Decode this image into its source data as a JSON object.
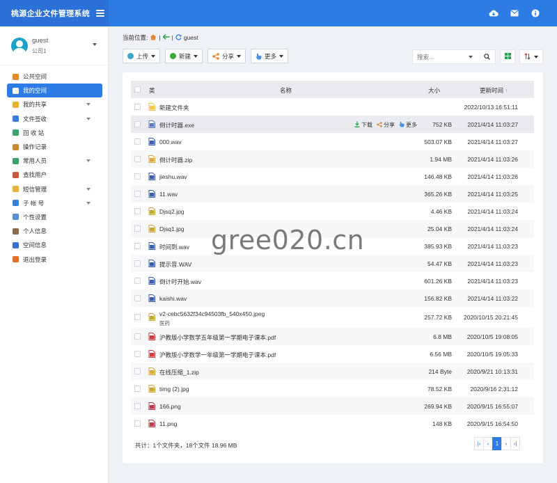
{
  "app": {
    "title": "桃源企业文件管理系统"
  },
  "header": {
    "icons": [
      "cloud-download-icon",
      "mail-icon",
      "info-icon"
    ]
  },
  "user": {
    "name": "guest",
    "company": "公司1"
  },
  "sidebar": {
    "items": [
      {
        "label": "公共空间",
        "icon": "public-space-icon",
        "color": "#e08a2e",
        "caret": false
      },
      {
        "label": "我的空间",
        "icon": "my-space-icon",
        "color": "#ffffff",
        "caret": false,
        "active": true
      },
      {
        "label": "我的共享",
        "icon": "share-folder-icon",
        "color": "#e6b23a",
        "caret": true
      },
      {
        "label": "文件签收",
        "icon": "sign-icon",
        "color": "#3a7fd6",
        "caret": true
      },
      {
        "label": "回 收 站",
        "icon": "recycle-icon",
        "color": "#3aa36b",
        "caret": false
      },
      {
        "label": "操作记录",
        "icon": "log-icon",
        "color": "#c58a3a",
        "caret": false
      },
      {
        "label": "常用人员",
        "icon": "contacts-icon",
        "color": "#3aa36b",
        "caret": true
      },
      {
        "label": "查找用户",
        "icon": "find-user-icon",
        "color": "#c55a3a",
        "caret": false
      },
      {
        "label": "短信管理",
        "icon": "sms-icon",
        "color": "#e6b23a",
        "caret": true
      },
      {
        "label": "子 帐 号",
        "icon": "sub-account-icon",
        "color": "#3a7fd6",
        "caret": true
      },
      {
        "label": "个性设置",
        "icon": "settings-icon",
        "color": "#5a8fd6",
        "caret": false
      },
      {
        "label": "个人信息",
        "icon": "profile-icon",
        "color": "#8a6a4a",
        "caret": false
      },
      {
        "label": "空间信息",
        "icon": "space-info-icon",
        "color": "#3a6fd6",
        "caret": false
      },
      {
        "label": "退出登录",
        "icon": "logout-icon",
        "color": "#e0702e",
        "caret": false
      }
    ]
  },
  "breadcrumb": {
    "prefix": "当前位置:",
    "current": "guest",
    "sep": "|"
  },
  "toolbar": {
    "upload": "上传",
    "new": "新建",
    "share": "分享",
    "more": "更多"
  },
  "search": {
    "placeholder": "搜索..."
  },
  "table": {
    "headers": {
      "type": "类",
      "name": "名称",
      "size": "大小",
      "time": "更新时间"
    },
    "rows": [
      {
        "name": "新建文件夹",
        "sub": "",
        "size": "",
        "time": "2022/10/13 16:51:11",
        "icon": "folder-icon",
        "color": "#f0c74a"
      },
      {
        "name": "倒计时器.exe",
        "sub": "",
        "size": "752 KB",
        "time": "2021/4/14 11:03:27",
        "icon": "exe-file-icon",
        "color": "#5a7ab8",
        "hover": true
      },
      {
        "name": "000.wav",
        "sub": "",
        "size": "503.07 KB",
        "time": "2021/4/14 11:03:27",
        "icon": "audio-file-icon",
        "color": "#3a5fa8"
      },
      {
        "name": "倒计时器.zip",
        "sub": "",
        "size": "1.94 MB",
        "time": "2021/4/14 11:03:26",
        "icon": "zip-file-icon",
        "color": "#d9a83a"
      },
      {
        "name": "jieshu.wav",
        "sub": "",
        "size": "146.48 KB",
        "time": "2021/4/14 11:03:26",
        "icon": "audio-file-icon",
        "color": "#3a5fa8"
      },
      {
        "name": "11.wav",
        "sub": "",
        "size": "365.26 KB",
        "time": "2021/4/14 11:03:25",
        "icon": "audio-file-icon",
        "color": "#3a5fa8"
      },
      {
        "name": "Djsq2.jpg",
        "sub": "",
        "size": "4.46 KB",
        "time": "2021/4/14 11:03:24",
        "icon": "image-file-icon",
        "color": "#c9a23a"
      },
      {
        "name": "Djsq1.jpg",
        "sub": "",
        "size": "25.04 KB",
        "time": "2021/4/14 11:03:24",
        "icon": "image-file-icon",
        "color": "#c9a23a"
      },
      {
        "name": "时间到.wav",
        "sub": "",
        "size": "385.93 KB",
        "time": "2021/4/14 11:03:23",
        "icon": "audio-file-icon",
        "color": "#3a5fa8"
      },
      {
        "name": "提示音.WAV",
        "sub": "",
        "size": "54.47 KB",
        "time": "2021/4/14 11:03:23",
        "icon": "audio-file-icon",
        "color": "#3a5fa8"
      },
      {
        "name": "倒计时开始.wav",
        "sub": "",
        "size": "601.26 KB",
        "time": "2021/4/14 11:03:23",
        "icon": "audio-file-icon",
        "color": "#3a5fa8"
      },
      {
        "name": "kaishi.wav",
        "sub": "",
        "size": "156.82 KB",
        "time": "2021/4/14 11:03:22",
        "icon": "audio-file-icon",
        "color": "#3a5fa8"
      },
      {
        "name": "v2-cebc5632f34c94503fb_540x450.jpeg",
        "sub": "医药",
        "size": "257.72 KB",
        "time": "2020/10/15 20:21:45",
        "icon": "image-file-icon",
        "color": "#c9a23a"
      },
      {
        "name": "沪教版小学数学五年级第一学期电子课本.pdf",
        "sub": "",
        "size": "6.8 MB",
        "time": "2020/10/5 19:08:05",
        "icon": "pdf-file-icon",
        "color": "#d23a3a"
      },
      {
        "name": "沪教版小学数学一年级第一学期电子课本.pdf",
        "sub": "",
        "size": "6.56 MB",
        "time": "2020/10/5 19:05:33",
        "icon": "pdf-file-icon",
        "color": "#d23a3a"
      },
      {
        "name": "在线压缩_1.zip",
        "sub": "",
        "size": "214 Byte",
        "time": "2020/9/21 10:13:31",
        "icon": "zip-file-icon",
        "color": "#d9a83a"
      },
      {
        "name": "timg (2).jpg",
        "sub": "",
        "size": "78.52 KB",
        "time": "2020/9/16 2:31:12",
        "icon": "image-file-icon",
        "color": "#c9a23a"
      },
      {
        "name": "166.png",
        "sub": "",
        "size": "269.94 KB",
        "time": "2020/9/15 16:55:07",
        "icon": "png-file-icon",
        "color": "#b83a4a"
      },
      {
        "name": "11.png",
        "sub": "",
        "size": "148 KB",
        "time": "2020/9/15 16:54:50",
        "icon": "png-file-icon",
        "color": "#b83a4a"
      }
    ],
    "row_actions": {
      "download": "下载",
      "share": "分享",
      "more": "更多"
    }
  },
  "footer": {
    "stats": "共计：1个文件夹，18个文件 18.96 MB"
  },
  "pager": {
    "first": "|‹",
    "prev": "‹",
    "current": "1",
    "next": "›",
    "last": "›|"
  },
  "watermark": "gree020.cn",
  "colors": {
    "primary": "#2d7ce6",
    "brand_bg": "#2a70d6"
  }
}
